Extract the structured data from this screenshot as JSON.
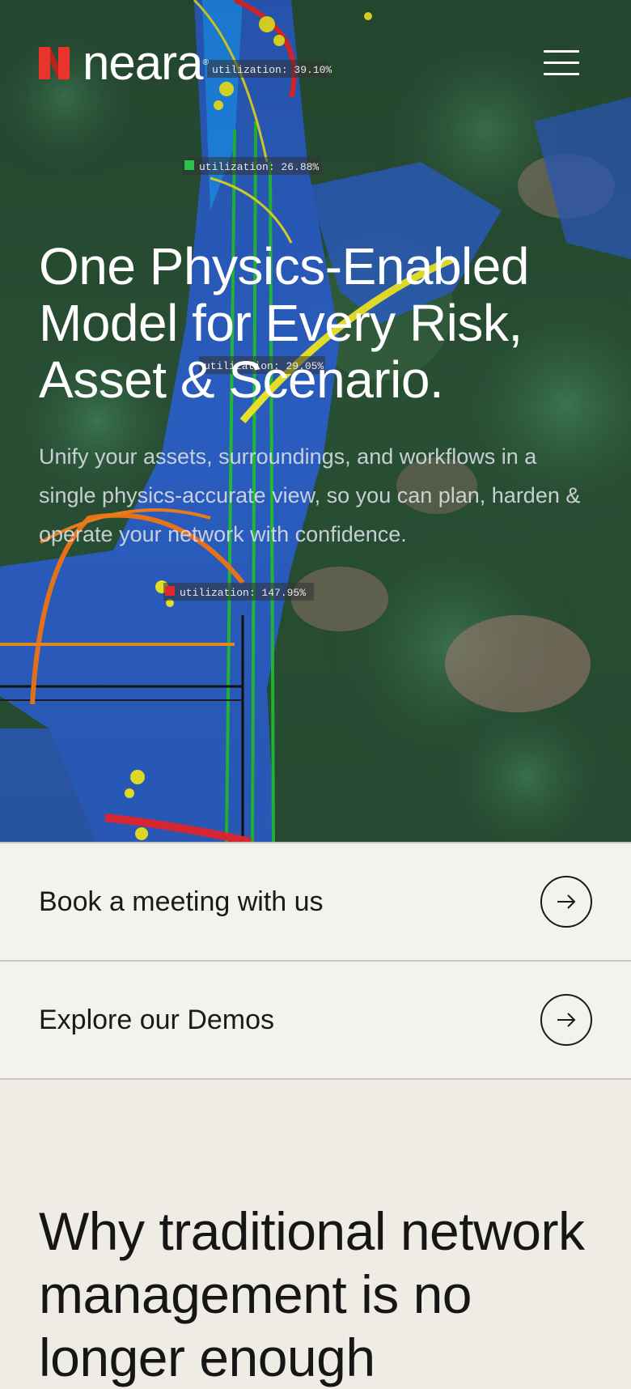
{
  "header": {
    "brand": "neara",
    "registered_mark": "®",
    "logo_icon": "neara-logo-mark",
    "menu_icon": "hamburger-menu-icon",
    "logo_color": "#e8342a"
  },
  "hero": {
    "title": "One Physics-Enabled Model for Every Risk, Asset & Scenario.",
    "subtitle": "Unify your assets, surroundings, and workflows in a single physics-accurate view, so you can plan, harden & operate your network with confidence.",
    "labels": [
      "utilization: 39.10%",
      "utilization: 26.88%",
      "utilization: 29.05%",
      "utilization: 147.95%"
    ]
  },
  "cta": {
    "items": [
      {
        "label": "Book a meeting with us",
        "icon": "arrow-right-icon"
      },
      {
        "label": "Explore our Demos",
        "icon": "arrow-right-icon"
      }
    ]
  },
  "section2": {
    "heading": "Why traditional network management is no longer enough"
  }
}
